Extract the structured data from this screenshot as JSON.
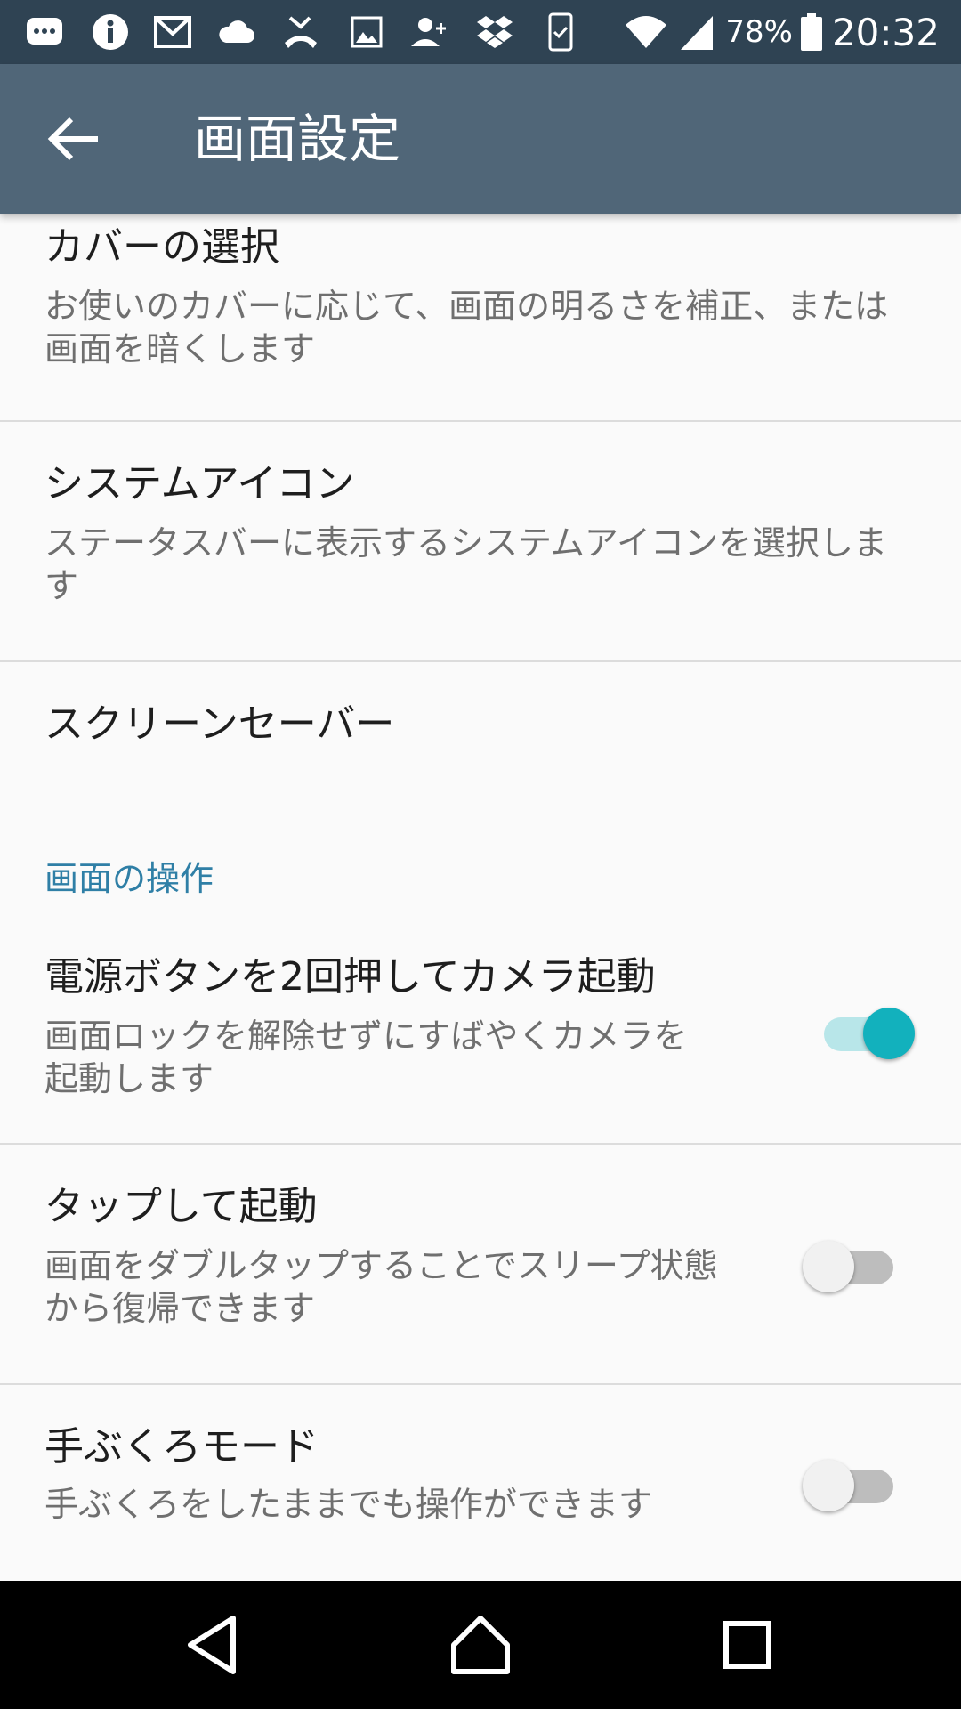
{
  "status_bar": {
    "battery_percent": "78%",
    "time": "20:32",
    "notification_icons": [
      "sms-icon",
      "info-icon",
      "gmail-icon",
      "cloud-icon",
      "missed-call-icon",
      "image-icon",
      "add-contact-icon",
      "dropbox-icon",
      "phone-check-icon"
    ]
  },
  "app_bar": {
    "title": "画面設定",
    "back_icon": "arrow-back-icon",
    "color": "#506678"
  },
  "settings": {
    "cover": {
      "title": "カバーの選択",
      "summary": "お使いのカバーに応じて、画面の明るさを補正、または画面を暗くします"
    },
    "system_icons": {
      "title": "システムアイコン",
      "summary": "ステータスバーに表示するシステムアイコンを選択します"
    },
    "screensaver": {
      "title": "スクリーンセーバー"
    },
    "section_header": "画面の操作",
    "camera_launch": {
      "title": "電源ボタンを2回押してカメラ起動",
      "summary": "画面ロックを解除せずにすばやくカメラを起動します",
      "enabled": true
    },
    "tap_to_wake": {
      "title": "タップして起動",
      "summary": "画面をダブルタップすることでスリープ状態から復帰できます",
      "enabled": false
    },
    "glove_mode": {
      "title": "手ぶくろモード",
      "summary": "手ぶくろをしたままでも操作ができます",
      "enabled": false
    }
  },
  "colors": {
    "accent": "#12b1bd",
    "section_header": "#2f7fa6",
    "status_bar": "#2f4353"
  },
  "nav_bar": {
    "icons": [
      "back-triangle-icon",
      "home-icon",
      "recents-icon"
    ]
  }
}
